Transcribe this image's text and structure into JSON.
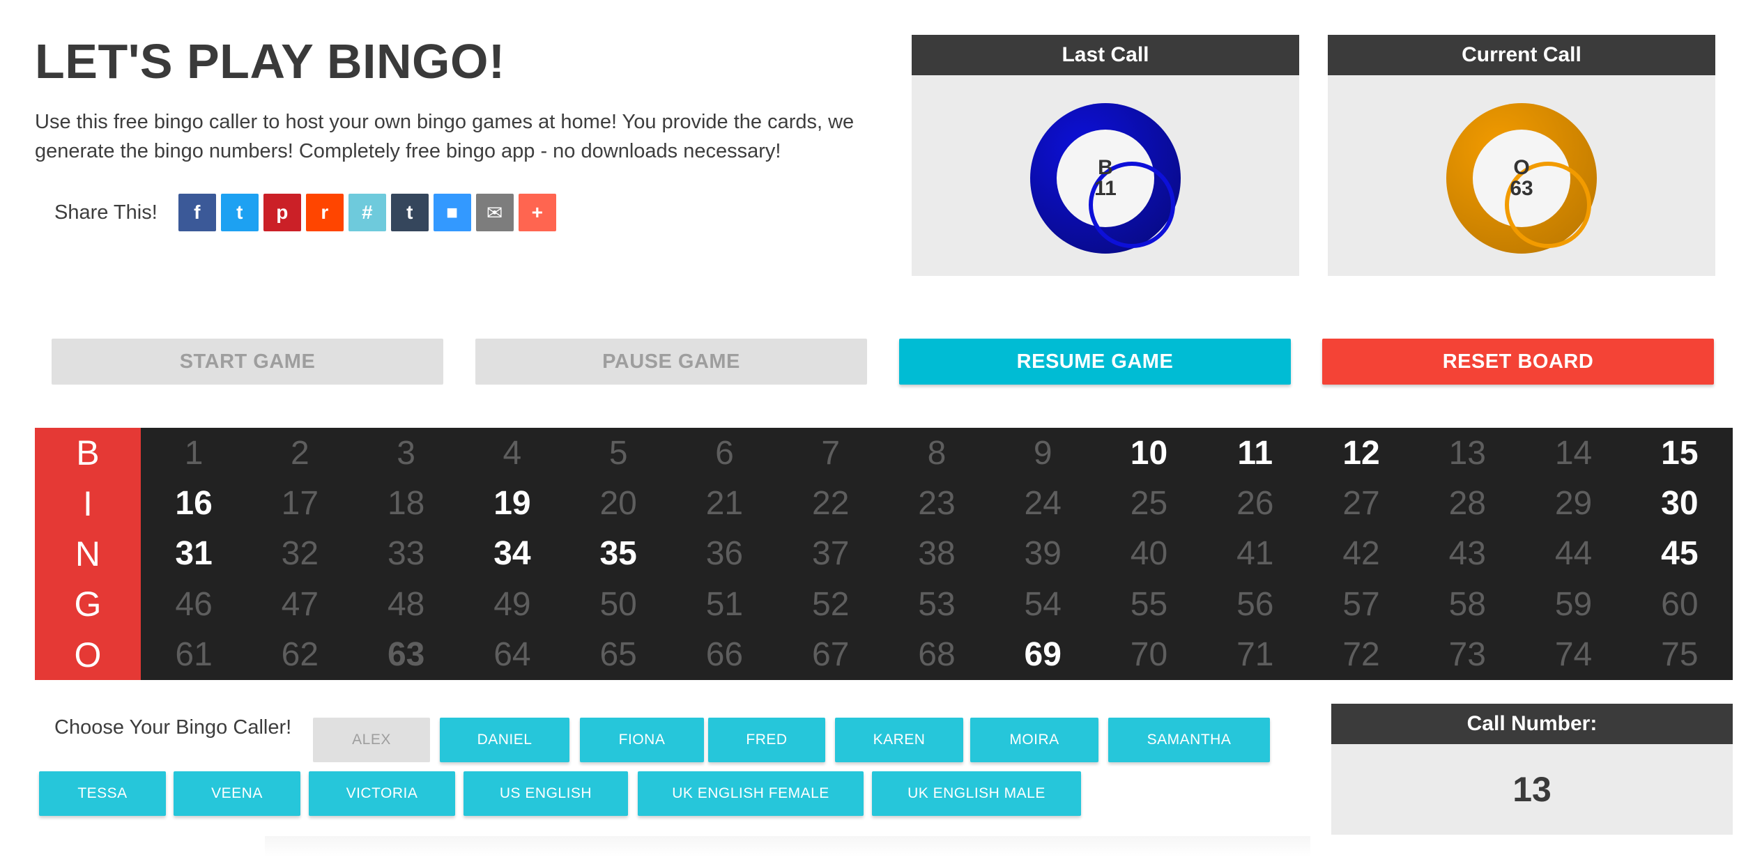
{
  "header": {
    "title": "LET'S PLAY BINGO!",
    "intro": "Use this free bingo caller to host your own bingo games at home! You provide the cards, we generate the bingo numbers! Completely free bingo app - no downloads necessary!"
  },
  "share": {
    "label": "Share This!",
    "buttons": [
      {
        "icon": "facebook-icon",
        "glyph": "f",
        "color": "#3b5998"
      },
      {
        "icon": "twitter-icon",
        "glyph": "t",
        "color": "#1da1f2"
      },
      {
        "icon": "pinterest-icon",
        "glyph": "p",
        "color": "#cb2027"
      },
      {
        "icon": "reddit-icon",
        "glyph": "r",
        "color": "#ff4500"
      },
      {
        "icon": "slack-icon",
        "glyph": "#",
        "color": "#6ecadc"
      },
      {
        "icon": "tumblr-icon",
        "glyph": "t",
        "color": "#35465c"
      },
      {
        "icon": "delicious-icon",
        "glyph": "■",
        "color": "#3399ff"
      },
      {
        "icon": "email-icon",
        "glyph": "✉",
        "color": "#7d7d7d"
      },
      {
        "icon": "more-icon",
        "glyph": "+",
        "color": "#ff6550"
      }
    ]
  },
  "last_call": {
    "heading": "Last Call",
    "letter": "B",
    "number": "11",
    "color": "#0d10d8"
  },
  "current_call": {
    "heading": "Current Call",
    "letter": "O",
    "number": "63",
    "color": "#f29b00"
  },
  "controls": {
    "start": "START GAME",
    "pause": "PAUSE GAME",
    "resume": "RESUME GAME",
    "reset": "RESET BOARD"
  },
  "board": {
    "letters": [
      "B",
      "I",
      "N",
      "G",
      "O"
    ],
    "called": [
      10,
      11,
      12,
      15,
      16,
      19,
      30,
      31,
      34,
      35,
      45,
      69
    ],
    "current": 63
  },
  "caller": {
    "label": "Choose Your Bingo Caller!",
    "voices": [
      "ALEX",
      "DANIEL",
      "FIONA",
      "FRED",
      "KAREN",
      "MOIRA",
      "SAMANTHA",
      "TESSA",
      "VEENA",
      "VICTORIA",
      "US ENGLISH",
      "UK ENGLISH FEMALE",
      "UK ENGLISH MALE"
    ],
    "selected": "ALEX"
  },
  "call_number": {
    "heading": "Call Number:",
    "value": "13"
  },
  "colors": {
    "accent": "#00bcd4",
    "danger": "#f44336",
    "board_bg": "#222222",
    "letter_bg": "#e53935"
  }
}
